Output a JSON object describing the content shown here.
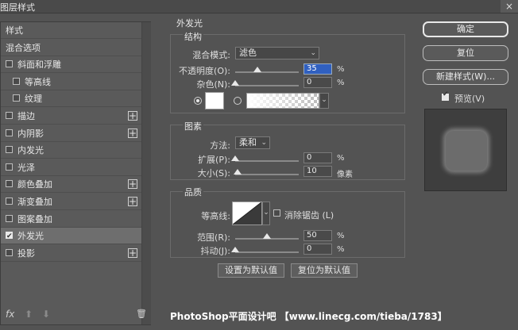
{
  "window": {
    "title": "图层样式",
    "close": "×"
  },
  "left_panel": {
    "items": [
      {
        "label": "样式",
        "checkbox": false,
        "checked": false,
        "plus": false,
        "selected": false,
        "indent": false
      },
      {
        "label": "混合选项",
        "checkbox": false,
        "checked": false,
        "plus": false,
        "selected": false,
        "indent": false
      },
      {
        "label": "斜面和浮雕",
        "checkbox": true,
        "checked": false,
        "plus": false,
        "selected": false,
        "indent": false
      },
      {
        "label": "等高线",
        "checkbox": true,
        "checked": false,
        "plus": false,
        "selected": false,
        "indent": true
      },
      {
        "label": "纹理",
        "checkbox": true,
        "checked": false,
        "plus": false,
        "selected": false,
        "indent": true
      },
      {
        "label": "描边",
        "checkbox": true,
        "checked": false,
        "plus": true,
        "selected": false,
        "indent": false
      },
      {
        "label": "内阴影",
        "checkbox": true,
        "checked": false,
        "plus": true,
        "selected": false,
        "indent": false
      },
      {
        "label": "内发光",
        "checkbox": true,
        "checked": false,
        "plus": false,
        "selected": false,
        "indent": false
      },
      {
        "label": "光泽",
        "checkbox": true,
        "checked": false,
        "plus": false,
        "selected": false,
        "indent": false
      },
      {
        "label": "颜色叠加",
        "checkbox": true,
        "checked": false,
        "plus": true,
        "selected": false,
        "indent": false
      },
      {
        "label": "渐变叠加",
        "checkbox": true,
        "checked": false,
        "plus": true,
        "selected": false,
        "indent": false
      },
      {
        "label": "图案叠加",
        "checkbox": true,
        "checked": false,
        "plus": false,
        "selected": false,
        "indent": false
      },
      {
        "label": "外发光",
        "checkbox": true,
        "checked": true,
        "plus": false,
        "selected": true,
        "indent": false
      },
      {
        "label": "投影",
        "checkbox": true,
        "checked": false,
        "plus": true,
        "selected": false,
        "indent": false
      }
    ],
    "plus_symbol": "+",
    "footer": {
      "fx": "fx",
      "up": "⬆",
      "down": "⬇",
      "trash": "🗑"
    }
  },
  "outer_glow": {
    "title": "外发光",
    "structure": {
      "title": "结构",
      "blend_mode_label": "混合模式:",
      "blend_mode_value": "滤色",
      "opacity_label": "不透明度(O):",
      "opacity_value": "35",
      "opacity_fraction": 0.35,
      "noise_label": "杂色(N):",
      "noise_value": "0",
      "noise_fraction": 0.0,
      "percent_unit": "%"
    },
    "elements": {
      "title": "图素",
      "technique_label": "方法:",
      "technique_value": "柔和",
      "spread_label": "扩展(P):",
      "spread_value": "0",
      "spread_fraction": 0.0,
      "size_label": "大小(S):",
      "size_value": "10",
      "size_fraction": 0.04,
      "percent_unit": "%",
      "pixel_unit": "像素"
    },
    "quality": {
      "title": "品质",
      "contour_label": "等高线:",
      "anti_alias_label": "消除锯齿 (L)",
      "range_label": "范围(R):",
      "range_value": "50",
      "range_fraction": 0.5,
      "jitter_label": "抖动(J):",
      "jitter_value": "0",
      "jitter_fraction": 0.0,
      "percent_unit": "%"
    },
    "set_default_label": "设置为默认值",
    "reset_default_label": "复位为默认值"
  },
  "right_panel": {
    "ok_label": "确定",
    "reset_label": "复位",
    "new_style_label": "新建样式(W)...",
    "preview_label": "预览(V)",
    "preview_checked": true
  },
  "watermark": "PhotoShop平面设计吧 【www.linecg.com/tieba/1783】",
  "colors": {
    "panel": "#535353",
    "selected_row": "#6e6e6e",
    "highlight": "#3060c0"
  }
}
